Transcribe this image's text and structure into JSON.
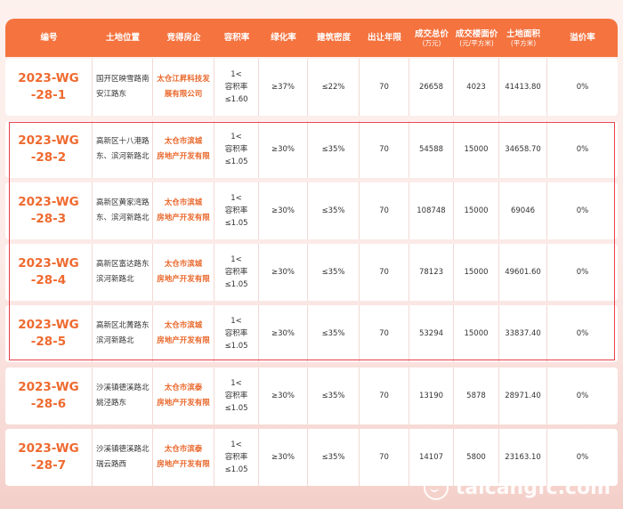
{
  "table": {
    "headers": [
      {
        "label": "编号",
        "sub": ""
      },
      {
        "label": "土地位置",
        "sub": ""
      },
      {
        "label": "竞得房企",
        "sub": ""
      },
      {
        "label": "容积率",
        "sub": ""
      },
      {
        "label": "绿化率",
        "sub": ""
      },
      {
        "label": "建筑密度",
        "sub": ""
      },
      {
        "label": "出让年限",
        "sub": ""
      },
      {
        "label": "成交总价",
        "sub": "(万元)"
      },
      {
        "label": "成交楼面价",
        "sub": "(元/平方米)"
      },
      {
        "label": "土地面积",
        "sub": "(平方米)"
      },
      {
        "label": "溢价率",
        "sub": ""
      }
    ],
    "rows": [
      {
        "code": "2023-WG\n-28-1",
        "location": "国开区映雪路南\n安江路东",
        "company": "太仓江昇科技发\n展有限公司",
        "far": "1<\n容积率\n≤1.60",
        "green": "≥37%",
        "density": "≤22%",
        "years": "70",
        "total_price": "26658",
        "floor_price": "4023",
        "area": "41413.80",
        "premium": "0%"
      },
      {
        "code": "2023-WG\n-28-2",
        "location": "高新区十八港路\n东、滨河新路北",
        "company": "太仓市滨城\n房地产开发有限",
        "far": "1<\n容积率\n≤1.05",
        "green": "≥30%",
        "density": "≤35%",
        "years": "70",
        "total_price": "54588",
        "floor_price": "15000",
        "area": "34658.70",
        "premium": "0%"
      },
      {
        "code": "2023-WG\n-28-3",
        "location": "高新区黄家湾路\n东、滨河新路北",
        "company": "太仓市滨城\n房地产开发有限",
        "far": "1<\n容积率\n≤1.05",
        "green": "≥30%",
        "density": "≤35%",
        "years": "70",
        "total_price": "108748",
        "floor_price": "15000",
        "area": "69046",
        "premium": "0%"
      },
      {
        "code": "2023-WG\n-28-4",
        "location": "高新区富达路东\n滨河新路北",
        "company": "太仓市滨城\n房地产开发有限",
        "far": "1<\n容积率\n≤1.05",
        "green": "≥30%",
        "density": "≤35%",
        "years": "70",
        "total_price": "78123",
        "floor_price": "15000",
        "area": "49601.60",
        "premium": "0%"
      },
      {
        "code": "2023-WG\n-28-5",
        "location": "高新区北菁路东\n滨河新路北",
        "company": "太仓市滨城\n房地产开发有限",
        "far": "1<\n容积率\n≤1.05",
        "green": "≥30%",
        "density": "≤35%",
        "years": "70",
        "total_price": "53294",
        "floor_price": "15000",
        "area": "33837.40",
        "premium": "0%"
      },
      {
        "code": "2023-WG\n-28-6",
        "location": "沙溪镇德溪路北\n姚泾路东",
        "company": "太仓市滨泰\n房地产开发有限",
        "far": "1<\n容积率\n≤1.05",
        "green": "≥30%",
        "density": "≤35%",
        "years": "70",
        "total_price": "13190",
        "floor_price": "5878",
        "area": "28971.40",
        "premium": "0%"
      },
      {
        "code": "2023-WG\n-28-7",
        "location": "沙溪镇德溪路北\n瑞云路西",
        "company": "太仓市滨泰\n房地产开发有限",
        "far": "1<\n容积率\n≤1.05",
        "green": "≥30%",
        "density": "≤35%",
        "years": "70",
        "total_price": "14107",
        "floor_price": "5800",
        "area": "23163.10",
        "premium": "0%"
      }
    ]
  },
  "watermark": {
    "text": "taicangfc.com",
    "icon": "smile-logo-icon"
  },
  "colors": {
    "header_bg": "#f4733f",
    "accent_text": "#ef6a2f",
    "highlight_border": "#e8404a"
  }
}
